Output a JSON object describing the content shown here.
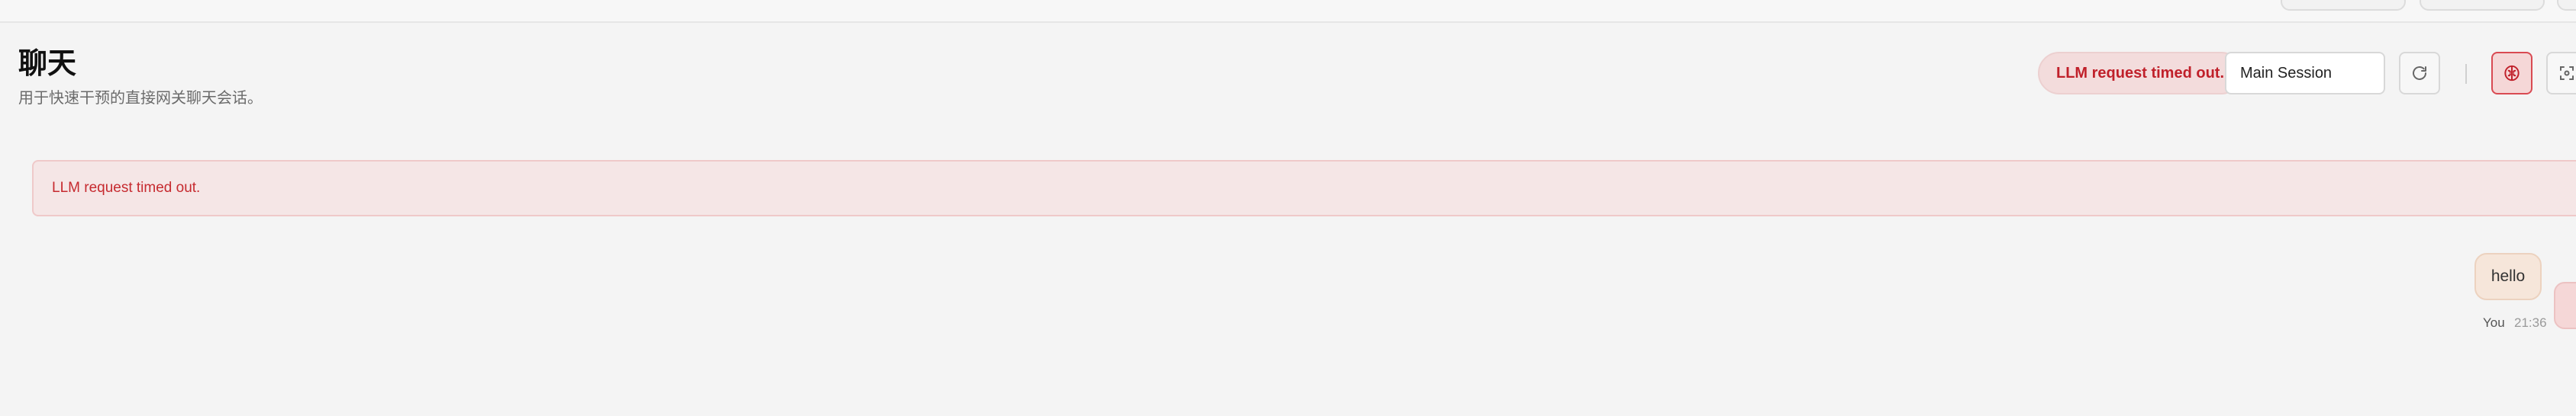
{
  "header": {
    "title": "聊天",
    "subtitle": "用于快速干预的直接网关聊天会话。"
  },
  "toolbar": {
    "error_pill": "LLM request timed out.",
    "session_select_value": "Main Session",
    "refresh_icon": "refresh-icon",
    "brain_icon": "brain-icon",
    "focus_icon": "focus-icon"
  },
  "banner": {
    "message": "LLM request timed out."
  },
  "chat": {
    "messages": [
      {
        "sender": "You",
        "text": "hello",
        "time": "21:36"
      }
    ]
  },
  "colors": {
    "error": "#c0202a",
    "error_bg": "#f3dcdc",
    "user_bubble": "#f6e6da"
  }
}
